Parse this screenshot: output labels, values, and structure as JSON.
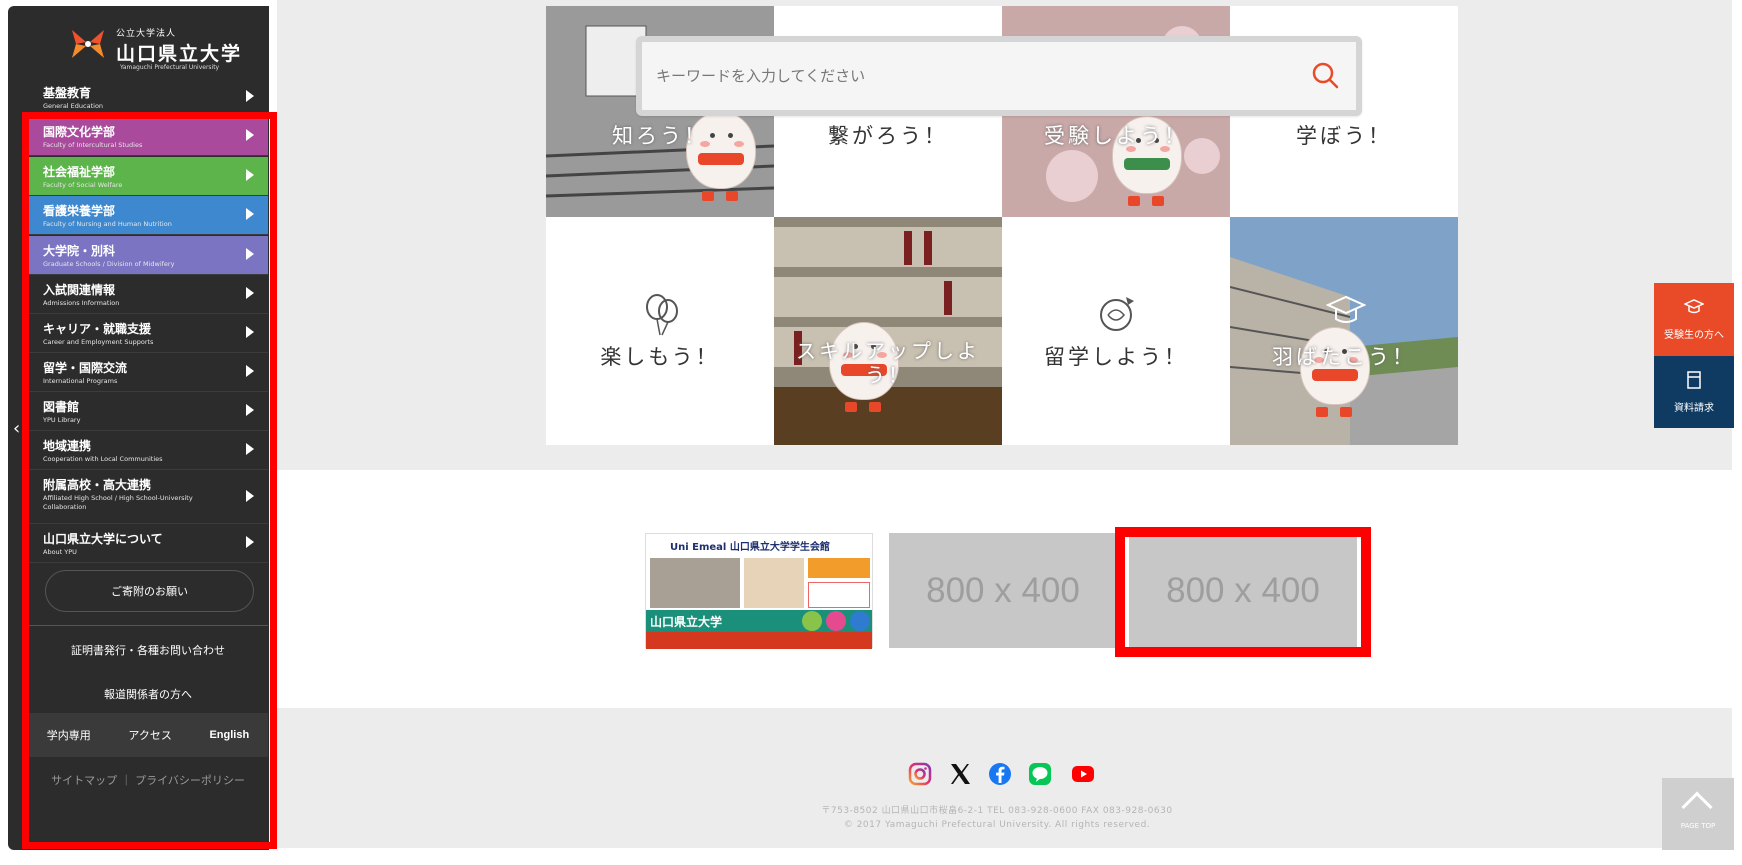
{
  "logo": {
    "small": "公立大学法人",
    "name": "山口県立大学",
    "en": "Yamaguchi Prefectural University"
  },
  "nav": [
    {
      "jp": "基盤教育",
      "en": "General Education",
      "color": "#2c2c2c"
    },
    {
      "jp": "国際文化学部",
      "en": "Faculty of Intercultural Studies",
      "color": "#a94a9c"
    },
    {
      "jp": "社会福祉学部",
      "en": "Faculty of Social Welfare",
      "color": "#5cb44a"
    },
    {
      "jp": "看護栄養学部",
      "en": "Faculty of Nursing and Human Nutrition",
      "color": "#3e88cf"
    },
    {
      "jp": "大学院・別科",
      "en": "Graduate Schools / Division of Midwifery",
      "color": "#7a74c3"
    },
    {
      "jp": "入試関連情報",
      "en": "Admissions Information",
      "color": "#2c2c2c"
    },
    {
      "jp": "キャリア・就職支援",
      "en": "Career and Employment Supports",
      "color": "#2c2c2c"
    },
    {
      "jp": "留学・国際交流",
      "en": "International Programs",
      "color": "#2c2c2c"
    },
    {
      "jp": "図書館",
      "en": "YPU Library",
      "color": "#2c2c2c"
    },
    {
      "jp": "地域連携",
      "en": "Cooperation with Local Communities",
      "color": "#2c2c2c"
    },
    {
      "jp": "附属高校・高大連携",
      "en": "Affiliated High School / High School-University Collaboration",
      "color": "#2c2c2c"
    },
    {
      "jp": "山口県立大学について",
      "en": "About YPU",
      "color": "#2c2c2c"
    }
  ],
  "donate": "ご寄附のお願い",
  "certificate": "証明書発行・各種お問い合わせ",
  "press": "報道関係者の方へ",
  "bottom_links": [
    "学内専用",
    "アクセス",
    "English"
  ],
  "footer_links": "サイトマップ ｜ プライバシーポリシー",
  "search": {
    "placeholder": "キーワードを入力してください"
  },
  "tiles": [
    {
      "label": "知ろう！"
    },
    {
      "label": "繋がろう！"
    },
    {
      "label": "受験しよう！"
    },
    {
      "label": "学ぼう！"
    },
    {
      "label": "楽しもう！"
    },
    {
      "label": "スキルアップしよう！"
    },
    {
      "label": "留学しよう！"
    },
    {
      "label": "羽ばたこう！"
    }
  ],
  "banners": {
    "b1_line1": "Uni Emeal 山口県立大学学生会館",
    "b1_line2": "山口県立大学",
    "b2": "800 x 400",
    "b3": "800 x 400"
  },
  "address": {
    "line1": "〒753-8502 山口県山口市桜畠6-2-1 TEL 083-928-0600 FAX 083-928-0630",
    "line2": "© 2017 Yamaguchi Prefectural University. All rights reserved."
  },
  "cta": {
    "exam": "受験生の方へ",
    "docs": "資料請求"
  },
  "pagetop": "PAGE TOP",
  "colors": {
    "accent": "#e94a28",
    "highlight": "#ff0000",
    "navy": "#0f3a62"
  }
}
